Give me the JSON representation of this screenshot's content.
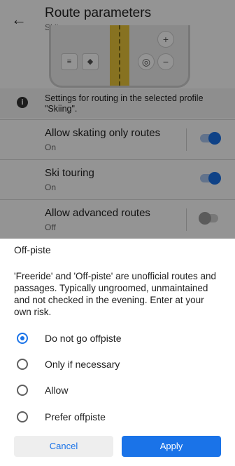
{
  "header": {
    "title": "Route parameters",
    "subtitle": "Skiing",
    "back_icon": "arrow-left-icon"
  },
  "preview": {
    "buttons": [
      "menu-icon",
      "directions-icon",
      "zoom-in-icon",
      "location-icon",
      "zoom-out-icon"
    ],
    "colors": {
      "road": "#e8c43a"
    }
  },
  "info": {
    "text": "Settings for routing in the selected profile \"Skiing\"."
  },
  "settings": [
    {
      "label": "Allow skating only routes",
      "state": "On",
      "enabled": true
    },
    {
      "label": "Ski touring",
      "state": "On",
      "enabled": true
    },
    {
      "label": "Allow advanced routes",
      "state": "Off",
      "enabled": false
    }
  ],
  "sheet": {
    "title": "Off-piste",
    "description": "'Freeride' and 'Off-piste' are unofficial routes and passages. Typically ungroomed, unmaintained and not checked in the evening. Enter at your own risk.",
    "options": [
      {
        "label": "Do not go offpiste",
        "selected": true
      },
      {
        "label": "Only if necessary",
        "selected": false
      },
      {
        "label": "Allow",
        "selected": false
      },
      {
        "label": "Prefer offpiste",
        "selected": false
      }
    ],
    "cancel_label": "Cancel",
    "apply_label": "Apply"
  },
  "colors": {
    "accent": "#1a73e8",
    "scrim": "rgba(0,0,0,0.42)"
  }
}
